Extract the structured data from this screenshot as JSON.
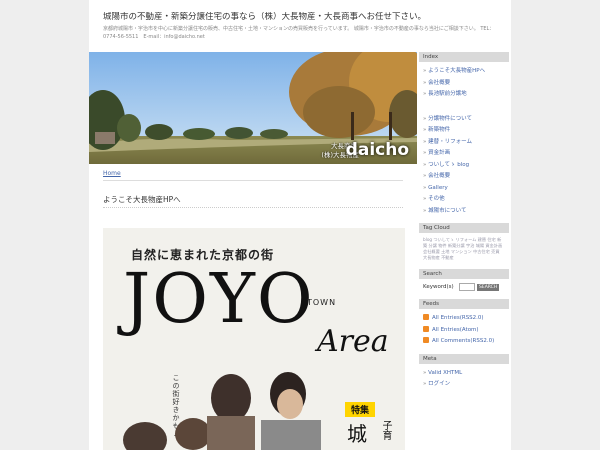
{
  "header": {
    "title": "城陽市の不動産・新築分譲住宅の事なら（株）大長物産・大長商事へお任せ下さい。",
    "description": "京都府城陽市・宇治市を中心に新築分譲住宅の販売、中古住宅・土地・マンションの売買販売を行っています。 城陽市・宇治市の不動産の事なら当社にご相談下さい。 TEL：0774-56-5511　E-mail：info@daicho.net"
  },
  "hero": {
    "company_line1": "大長商事",
    "company_line2": "(株)大長物産",
    "brand": "daicho"
  },
  "breadcrumb": {
    "home": "Home"
  },
  "post": {
    "title": "ようこそ大長物産HPへ"
  },
  "magazine": {
    "subtitle": "自然に恵まれた京都の街",
    "title": "JOYO",
    "town": "TOWN",
    "area": "Area",
    "vertical_text": "この街好きかも♪",
    "tokushu": "特集",
    "shiro": "城",
    "kosodate": "子育"
  },
  "sidebar": {
    "index_title": "Index",
    "index_items_a": [
      "ようこそ大長物産HPへ",
      "会社概要",
      "長池駅前分譲地"
    ],
    "index_items_b": [
      "分譲物件について",
      "新築物件",
      "建替・リフォーム",
      "資金計画",
      "ついしてゝ blog",
      "会社概要",
      "Gallery",
      "その他",
      "城陽市について"
    ],
    "tagcloud_title": "Tag Cloud",
    "tagcloud_text": "blog ついしてゝ リフォーム 建替 住宅 新築 分譲 物件 新築分譲 宇治 城陽 資金計画 会社概要 土地 マンション 中古住宅 売買 大長物産 不動産",
    "search_title": "Search",
    "search_label": "Keyword(s)",
    "search_button": "SEARCH",
    "feeds_title": "Feeds",
    "feeds": [
      "All Entries(RSS2.0)",
      "All Entries(Atom)",
      "All Comments(RSS2.0)"
    ],
    "meta_title": "Meta",
    "meta": [
      "Valid XHTML",
      "ログイン"
    ]
  },
  "colors": {
    "link": "#4466aa",
    "sidebar_head": "#d9d9d9",
    "tokushu": "#ffd400"
  }
}
